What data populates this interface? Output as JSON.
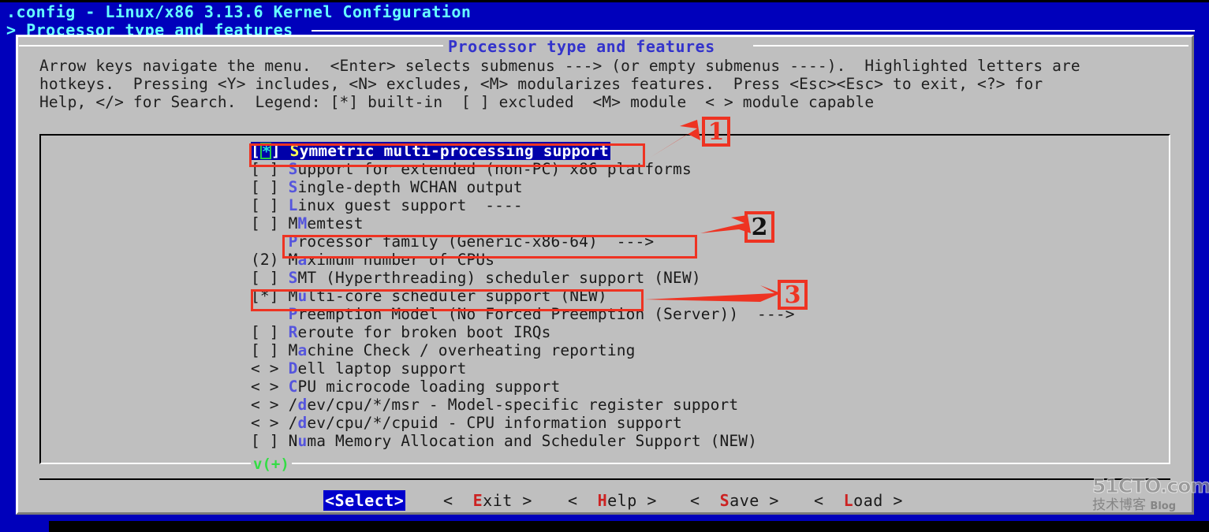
{
  "terminal": {
    "title": ".config - Linux/x86 3.13.6 Kernel Configuration",
    "path": "> Processor type and features"
  },
  "dialog": {
    "caption": "Processor type and features",
    "help": [
      "Arrow keys navigate the menu.  <Enter> selects submenus ---> (or empty submenus ----).  Highlighted letters are",
      "hotkeys.  Pressing <Y> includes, <N> excludes, <M> modularizes features.  Press <Esc><Esc> to exit, <?> for",
      "Help, </> for Search.  Legend: [*] built-in  [ ] excluded  <M> module  < > module capable"
    ]
  },
  "menu": {
    "scroll_marker": "v(+)",
    "items": [
      {
        "state": "[*]",
        "hotkey": "S",
        "rest": "ymmetric multi-processing support",
        "selected": true
      },
      {
        "state": "[ ]",
        "hotkey": "S",
        "rest": "upport for extended (non-PC) x86 platforms",
        "selected": false
      },
      {
        "state": "[ ]",
        "hotkey": "S",
        "rest": "ingle-depth WCHAN output",
        "selected": false
      },
      {
        "state": "[ ]",
        "hotkey": "L",
        "rest": "inux guest support  ----",
        "selected": false
      },
      {
        "state": "[ ]",
        "hotkey": "M",
        "pre": "M",
        "rest": "emtest",
        "selected": false
      },
      {
        "state": "   ",
        "hotkey": "P",
        "rest": "rocessor family (Generic-x86-64)  --->",
        "selected": false
      },
      {
        "state": "(2)",
        "hotkey": "a",
        "pre": "M",
        "rest": "ximum number of CPUs",
        "selected": false
      },
      {
        "state": "[ ]",
        "hotkey": "S",
        "rest": "MT (Hyperthreading) scheduler support (NEW)",
        "selected": false
      },
      {
        "state": "[*]",
        "hotkey": "u",
        "pre": "M",
        "rest": "lti-core scheduler support (NEW)",
        "selected": false
      },
      {
        "state": "   ",
        "hotkey": "P",
        "rest": "reemption Model (No Forced Preemption (Server))  --->",
        "selected": false
      },
      {
        "state": "[ ]",
        "hotkey": "R",
        "rest": "eroute for broken boot IRQs",
        "selected": false
      },
      {
        "state": "[ ]",
        "hotkey": "a",
        "pre": "M",
        "rest": "chine Check / overheating reporting",
        "selected": false
      },
      {
        "state": "< >",
        "hotkey": "D",
        "rest": "ell laptop support",
        "selected": false
      },
      {
        "state": "< >",
        "hotkey": "C",
        "rest": "PU microcode loading support",
        "selected": false
      },
      {
        "state": "< >",
        "hotkey": "d",
        "pre": "/",
        "rest": "ev/cpu/*/msr - Model-specific register support",
        "selected": false
      },
      {
        "state": "< >",
        "hotkey": "d",
        "pre": "/",
        "rest": "ev/cpu/*/cpuid - CPU information support",
        "selected": false
      },
      {
        "state": "[ ]",
        "hotkey": "u",
        "pre": "N",
        "rest": "ma Memory Allocation and Scheduler Support (NEW)",
        "selected": false
      }
    ]
  },
  "buttons": [
    {
      "text": "<Select>",
      "hotkey": "",
      "selected": true
    },
    {
      "prefix": "<  ",
      "hotkey": "E",
      "rest": "xit >",
      "selected": false
    },
    {
      "prefix": "<  ",
      "hotkey": "H",
      "rest": "elp >",
      "selected": false
    },
    {
      "prefix": "<  ",
      "hotkey": "S",
      "rest": "ave >",
      "selected": false
    },
    {
      "prefix": "<  ",
      "hotkey": "L",
      "rest": "oad >",
      "selected": false
    }
  ],
  "annotations": [
    {
      "number": "1",
      "color": "#ee3322"
    },
    {
      "number": "2",
      "color": "#111111"
    },
    {
      "number": "3",
      "color": "#ee3322"
    }
  ],
  "watermark": {
    "top": "51CTO.com",
    "bottom": "技术博客",
    "blog": "Blog"
  },
  "colors": {
    "terminal_bg": "#0000bb",
    "dialog_bg": "#bfbfbf",
    "selection_bg": "#0000aa",
    "hotkey": "#5555dd",
    "annotation_red": "#ee3322",
    "scroll_green": "#33dd44"
  }
}
